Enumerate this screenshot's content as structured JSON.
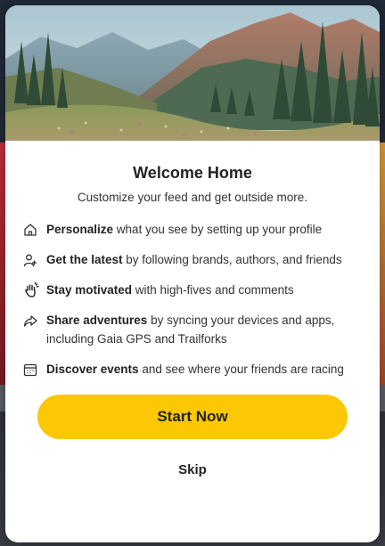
{
  "modal": {
    "hero_image": "mountain-valley-landscape",
    "title": "Welcome Home",
    "subtitle": "Customize your feed and get outside more."
  },
  "features": [
    {
      "icon": "home-icon",
      "bold": "Personalize",
      "rest": " what you see by setting up your profile"
    },
    {
      "icon": "add-user-icon",
      "bold": "Get the latest",
      "rest": " by following brands, authors, and friends"
    },
    {
      "icon": "high-five-hand-icon",
      "bold": "Stay motivated",
      "rest": " with high-fives and comments"
    },
    {
      "icon": "share-arrow-icon",
      "bold": "Share adventures",
      "rest": " by syncing your devices and apps, including Gaia GPS and Trailforks"
    },
    {
      "icon": "calendar-icon",
      "bold": "Discover events",
      "rest": " and see where your friends are racing"
    }
  ],
  "actions": {
    "primary_label": "Start Now",
    "skip_label": "Skip"
  },
  "colors": {
    "accent": "#fcc804",
    "text": "#222222"
  }
}
